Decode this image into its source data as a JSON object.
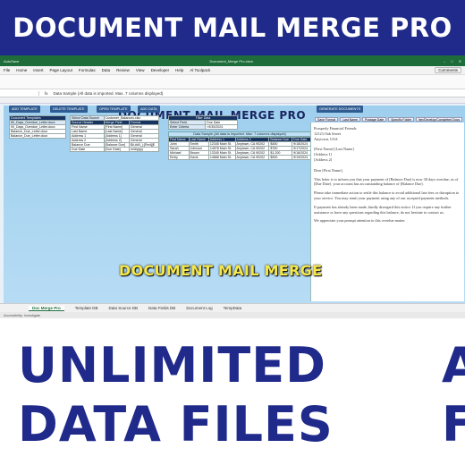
{
  "banner": {
    "title": "DOCUMENT MAIL MERGE PRO"
  },
  "window": {
    "autosave": "AutoSave",
    "filename": "Document_Merge Pro.xlsm",
    "comments": "Comments"
  },
  "menu": [
    "File",
    "Home",
    "Insert",
    "Page Layout",
    "Formulas",
    "Data",
    "Review",
    "View",
    "Developer",
    "Help",
    "Al Toolpack"
  ],
  "formula_bar": {
    "message": "Data Sample (All data is imported. Max. 7 columns displayed)"
  },
  "sheet": {
    "title": "DOCUMENT MAIL MERGE PRO",
    "buttons": {
      "add_template": "ADD TEMPLATE",
      "delete_template": "DELETE TEMPLATE",
      "open_template": "OPEN TEMPLATE",
      "add_data": "ADD DATA",
      "generate": "GENERATE DOCUMENTS"
    },
    "templates": {
      "header": "Document Templates",
      "items": [
        "60_Days_Overdue_Letter.docx",
        "90_Days_Overdue_Letter.docx",
        "Balance_Due_Letter.docx",
        "Balance_Due_Letter.docx"
      ]
    },
    "source": {
      "label": "Select Data Source",
      "value": "Customer_Balances.xlsx",
      "headers": [
        "Source Header",
        "Merge Field",
        "Format"
      ],
      "rows": [
        [
          "First Name",
          "[First Name]",
          "General"
        ],
        [
          "Last Name",
          "[Last Name]",
          "General"
        ],
        [
          "Address 1",
          "[Address 1]",
          "General"
        ],
        [
          "Address 2",
          "[Address 2]",
          "General"
        ],
        [
          "Balance Due",
          "[Balance Due]",
          "$#,##0_);[Red]($"
        ],
        [
          "Due Date",
          "[Due Date]",
          "m/d/yyyy"
        ]
      ]
    },
    "filter": {
      "header": "Filter Data",
      "field_label": "Select Field",
      "field_value": "Due Date",
      "criteria_label": "Enter Criteria",
      "criteria_value": "<9/30/2024"
    },
    "sample": {
      "caption": "Data Sample (All data is imported. Max. 7 columns displayed)",
      "headers": [
        "First Name",
        "Last Name",
        "Address 1",
        "Address 2",
        "Balance Due",
        "Due Date"
      ],
      "rows": [
        [
          "John",
          "Smith",
          "12345 Main St.",
          "Anytown, CA 90202",
          "$450",
          "9/18/2024"
        ],
        [
          "Sarah",
          "Johnson",
          "14578 Main St.",
          "Anytown, CA 90202",
          "$750",
          "9/17/2024"
        ],
        [
          "Michael",
          "Brown",
          "13345 Main St.",
          "Anytown, CA 90202",
          "$1,200",
          "9/16/2024"
        ],
        [
          "Emily",
          "Davis",
          "14668 Main St.",
          "Anytown, CA 90202",
          "$900",
          "9/19/2024"
        ]
      ]
    },
    "save_bar": [
      "Save Format",
      "Last Name",
      "Postage Date",
      "Specific Folder",
      "tter/Develop/Completed Docs"
    ],
    "letter": {
      "company": "Prosperly Financial Friends",
      "street": "12123 Oak Street",
      "city": "Anytown, USA",
      "recipient": [
        "[First Name] [Last Name]",
        "[Address 1]",
        "[Address 2]"
      ],
      "salutation": "Dear [First Name],",
      "p1": "This letter is to inform you that your payment of [Balance Due] is now 30 days overdue, as of [Due Date]. your account has an outstanding balance of [Balance Due].",
      "p2": "Please take immediate action to settle this balance to avoid additional late fees or disruption to your service. You may remit your payment using any of our accepted payment methods.",
      "p3": "If payment has already been made, kindly disregard this notice. If you require any further assistance or have any questions regarding this balance, do not hesitate to contact us.",
      "p4": "We appreciate your prompt attention to this overdue matter."
    }
  },
  "overlay_caption": "DOCUMENT MAIL MERGE",
  "tabs": [
    "Doc Merge Pro",
    "Template DB",
    "Data Source DB",
    "Data Fields DB",
    "Document Log",
    "TempData"
  ],
  "status": "Accessibility: Investigate",
  "promo": {
    "line1": "UNLIMITED",
    "line2": "DATA FILES",
    "edge1": "A",
    "edge2": "F"
  }
}
